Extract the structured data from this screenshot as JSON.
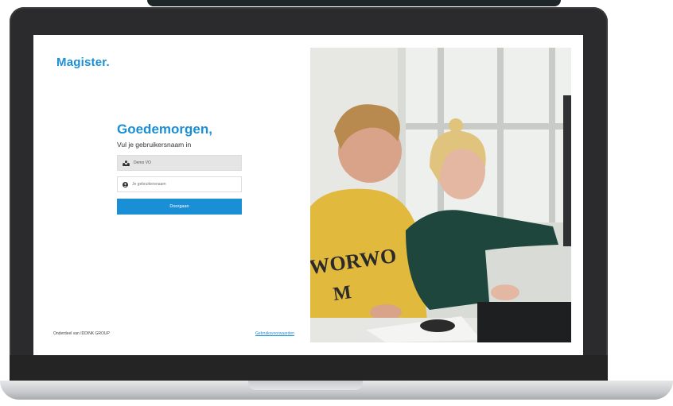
{
  "brand": {
    "logo_text": "Magister.",
    "accent": "#1a8fd6"
  },
  "login": {
    "greeting": "Goedemorgen,",
    "subtitle": "Vul je gebruikersnaam in",
    "school_value": "Demo VO",
    "username_placeholder": "Je gebruikersnaam",
    "next_button": "Doorgaan"
  },
  "footer": {
    "left_text": "Onderdeel van IDDINK GROUP",
    "link_text": "Gebruiksvoorwaarden"
  },
  "icons": {
    "school": "school-icon",
    "user": "user-icon"
  }
}
